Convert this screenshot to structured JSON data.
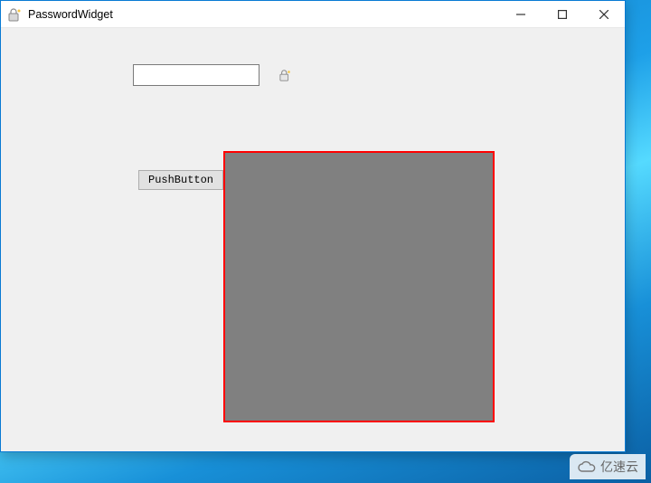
{
  "window": {
    "title": "PasswordWidget"
  },
  "lineedit": {
    "value": "",
    "placeholder": ""
  },
  "button": {
    "push_label": "PushButton"
  },
  "panel": {
    "bg": "#808080",
    "border": "#ff0000"
  },
  "watermark": {
    "text": "亿速云"
  }
}
